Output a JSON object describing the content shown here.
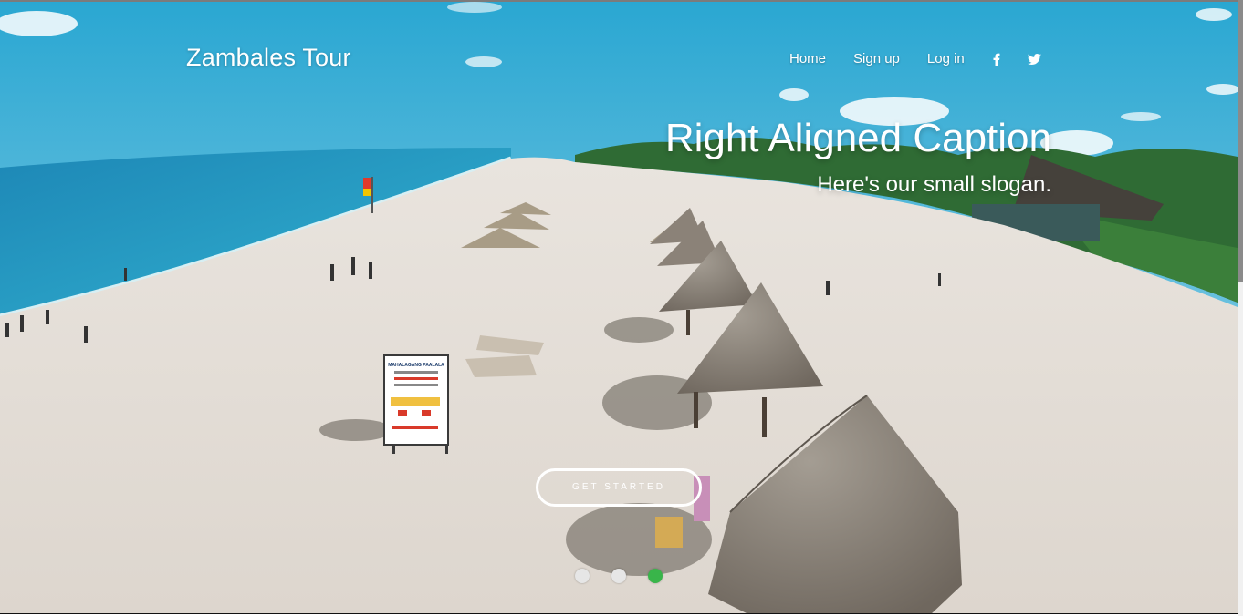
{
  "navbar": {
    "brand": "Zambales Tour",
    "links": [
      {
        "label": "Home"
      },
      {
        "label": "Sign up"
      },
      {
        "label": "Log in"
      }
    ],
    "social": [
      {
        "icon": "facebook-icon"
      },
      {
        "icon": "twitter-icon"
      }
    ]
  },
  "hero": {
    "title": "Right Aligned Caption",
    "slogan": "Here's our small slogan.",
    "cta_label": "GET STARTED"
  },
  "carousel": {
    "slide_count": 3,
    "active_index": 2,
    "active_color": "#39b54a",
    "inactive_color": "#e6e6e6"
  },
  "sign": {
    "heading": "MAHALAGANG PAALALA"
  }
}
